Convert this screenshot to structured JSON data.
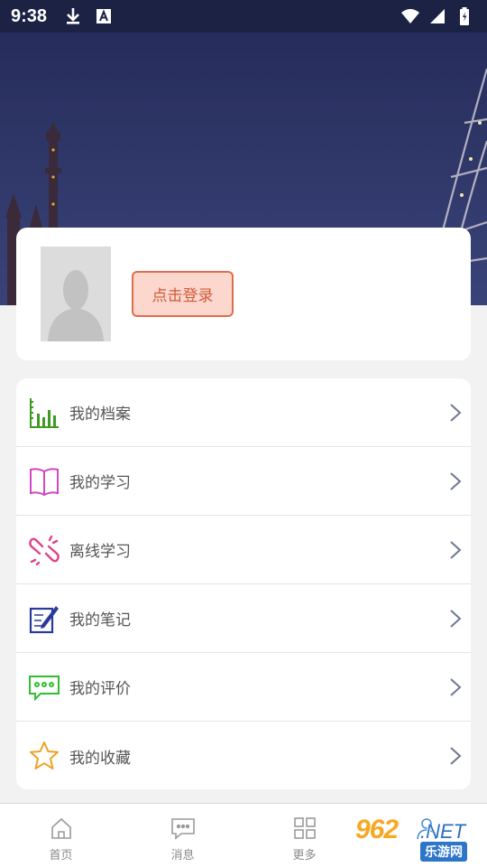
{
  "status_bar": {
    "time": "9:38",
    "icons": [
      "download-icon",
      "text-a-icon",
      "wifi-icon",
      "signal-icon",
      "battery-icon"
    ]
  },
  "profile": {
    "login_label": "点击登录",
    "avatar": "default-avatar-silhouette"
  },
  "menu": {
    "items": [
      {
        "label": "我的档案",
        "icon": "bar-chart-icon",
        "color": "#3f9a22"
      },
      {
        "label": "我的学习",
        "icon": "open-book-icon",
        "color": "#d146c2"
      },
      {
        "label": "离线学习",
        "icon": "broken-link-icon",
        "color": "#e0418b"
      },
      {
        "label": "我的笔记",
        "icon": "note-pen-icon",
        "color": "#2a3a9c"
      },
      {
        "label": "我的评价",
        "icon": "chat-bubble-icon",
        "color": "#2fbf2f"
      },
      {
        "label": "我的收藏",
        "icon": "star-icon",
        "color": "#f0a224"
      }
    ]
  },
  "tabbar": {
    "tabs": [
      {
        "label": "首页",
        "icon": "home-icon"
      },
      {
        "label": "消息",
        "icon": "message-icon"
      },
      {
        "label": "更多",
        "icon": "grid-icon"
      },
      {
        "label": "",
        "icon": "user-icon"
      }
    ]
  },
  "watermark": {
    "brand": "962",
    "net": ".NET",
    "sub": "乐游网"
  },
  "colors": {
    "login_border": "#de6f4d",
    "login_bg": "#fbd7cd",
    "hero": "#2c3468"
  }
}
